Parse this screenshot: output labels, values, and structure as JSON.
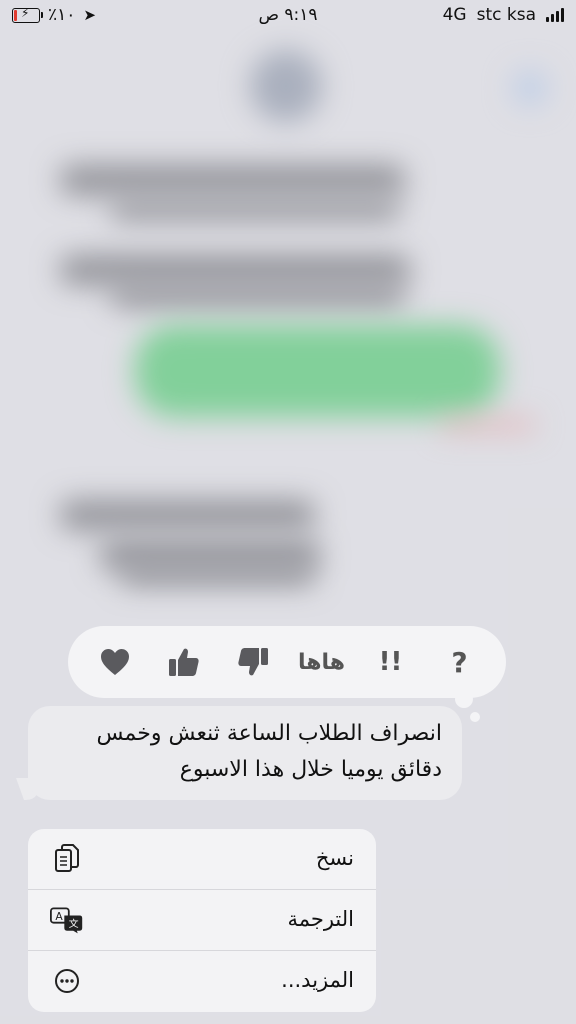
{
  "status_bar": {
    "battery_percent": "٪١٠",
    "battery_level": 0.1,
    "time": "٩:١٩ ص",
    "network": "4G",
    "carrier": "stc ksa"
  },
  "reactions": [
    {
      "name": "heart-icon"
    },
    {
      "name": "thumbs-up-icon"
    },
    {
      "name": "thumbs-down-icon"
    },
    {
      "name": "haha",
      "label": "هاها"
    },
    {
      "name": "exclamation",
      "label": "!!"
    },
    {
      "name": "question",
      "label": "?"
    }
  ],
  "message": {
    "line1": "انصراف الطلاب الساعة ثنعش وخمس",
    "line2": "دقائق  يوميا خلال هذا الاسبوع"
  },
  "menu": {
    "copy": "نسخ",
    "translate": "الترجمة",
    "more": "المزيد..."
  },
  "colors": {
    "accent_green": "#36c35c",
    "battery_red": "#e03b30"
  }
}
